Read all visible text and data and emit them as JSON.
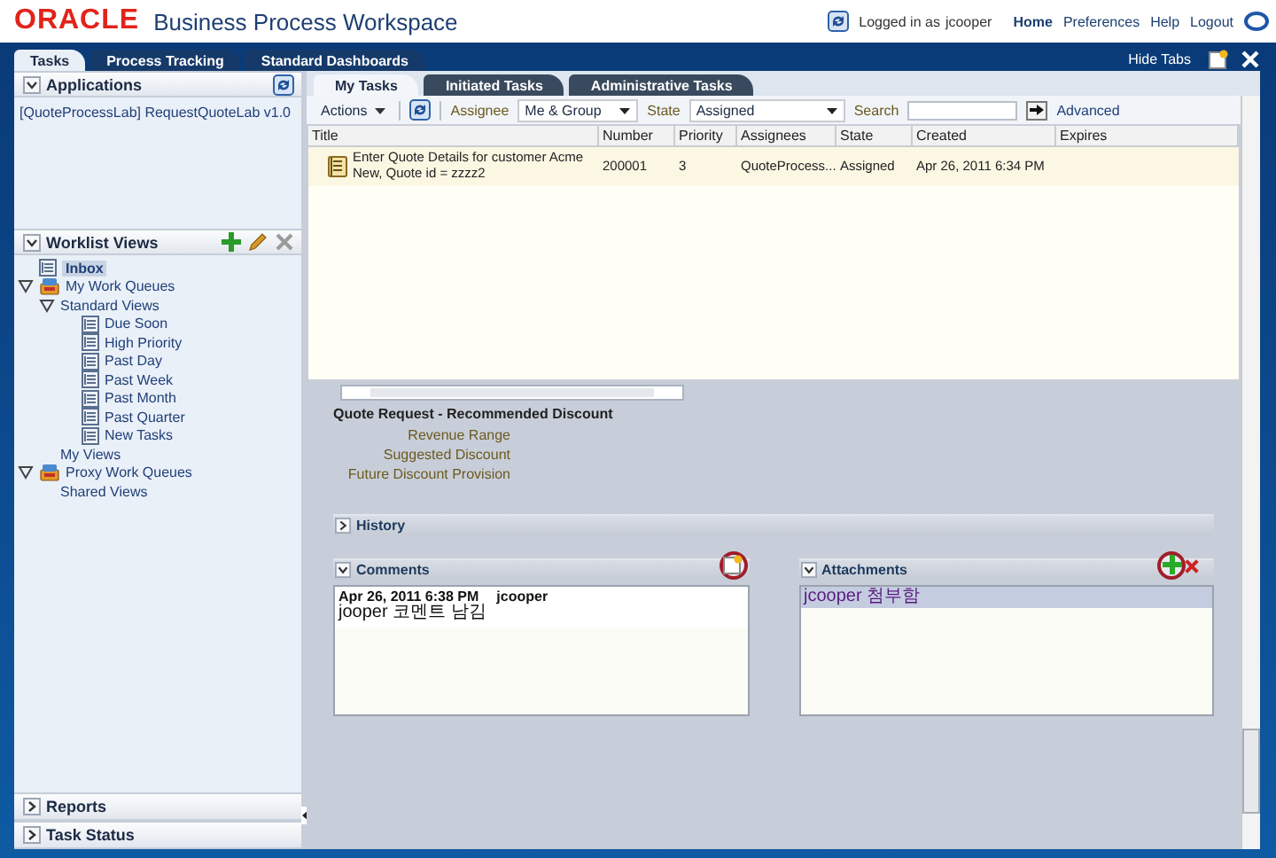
{
  "header": {
    "logo": "ORACLE",
    "title": "Business Process Workspace",
    "user_label": "Logged in as",
    "user": "jcooper",
    "links": [
      {
        "label": "Home",
        "selected": true
      },
      {
        "label": "Preferences",
        "selected": false
      },
      {
        "label": "Help",
        "selected": false
      },
      {
        "label": "Logout",
        "selected": false
      }
    ]
  },
  "main_tabs": [
    {
      "label": "Tasks",
      "selected": true
    },
    {
      "label": "Process Tracking",
      "selected": false
    },
    {
      "label": "Standard Dashboards",
      "selected": false
    }
  ],
  "hide_tabs": "Hide Tabs",
  "sidebar": {
    "applications": {
      "title": "Applications",
      "expanded": true,
      "items": [
        "[QuoteProcessLab] RequestQuoteLab v1.0"
      ]
    },
    "worklist_views": {
      "title": "Worklist Views",
      "expanded": true,
      "tree": [
        {
          "label": "Inbox",
          "kind": "view",
          "selected": true
        },
        {
          "label": "My Work Queues",
          "kind": "queue",
          "selected": false,
          "expanded": true,
          "children": [
            {
              "label": "Standard Views",
              "selected": false,
              "expanded": true,
              "children": [
                {
                  "label": "Due Soon",
                  "kind": "view",
                  "selected": false
                },
                {
                  "label": "High Priority",
                  "kind": "view",
                  "selected": false
                },
                {
                  "label": "Past Day",
                  "kind": "view",
                  "selected": false
                },
                {
                  "label": "Past Week",
                  "kind": "view",
                  "selected": false
                },
                {
                  "label": "Past Month",
                  "kind": "view",
                  "selected": false
                },
                {
                  "label": "Past Quarter",
                  "kind": "view",
                  "selected": false
                },
                {
                  "label": "New Tasks",
                  "kind": "view",
                  "selected": false
                }
              ]
            },
            {
              "label": "My Views",
              "selected": false
            }
          ]
        },
        {
          "label": "Proxy Work Queues",
          "kind": "queue",
          "selected": false,
          "expanded": true,
          "children": [
            {
              "label": "Shared Views",
              "selected": false
            }
          ]
        }
      ]
    },
    "bottom_panels": [
      {
        "title": "Reports",
        "expanded": false
      },
      {
        "title": "Task Status",
        "expanded": false
      }
    ]
  },
  "task_tabs": [
    {
      "label": "My Tasks",
      "selected": true
    },
    {
      "label": "Initiated Tasks",
      "selected": false
    },
    {
      "label": "Administrative Tasks",
      "selected": false
    }
  ],
  "toolbar": {
    "actions": "Actions",
    "assignee": {
      "label": "Assignee",
      "value": "Me & Group"
    },
    "state": {
      "label": "State",
      "value": "Assigned"
    },
    "search": {
      "label": "Search"
    },
    "advanced": "Advanced"
  },
  "table": {
    "columns": [
      "Title",
      "Number",
      "Priority",
      "Assignees",
      "State",
      "Created",
      "Expires"
    ],
    "rows": [
      {
        "selected": true,
        "cells": [
          "Enter Quote Details for customer Acme New, Quote id = zzzz2",
          "200001",
          "3",
          "QuoteProcess...",
          "Assigned",
          "Apr 26, 2011 6:34 PM"
        ]
      }
    ]
  },
  "details": {
    "title": "Quote Request - Recommended Discount",
    "fields": [
      "Revenue Range",
      "Suggested Discount",
      "Future Discount Provision"
    ],
    "history": {
      "title": "History",
      "expanded": false
    },
    "comments": {
      "title": "Comments",
      "expanded": true,
      "entries": [
        {
          "date": "Apr 26, 2011 6:38 PM",
          "author": "jcooper",
          "text": "jooper 코멘트 남김"
        }
      ]
    },
    "attachments": {
      "title": "Attachments",
      "expanded": true,
      "items": [
        {
          "label": "jcooper 첨부함",
          "selected": true
        }
      ]
    }
  }
}
